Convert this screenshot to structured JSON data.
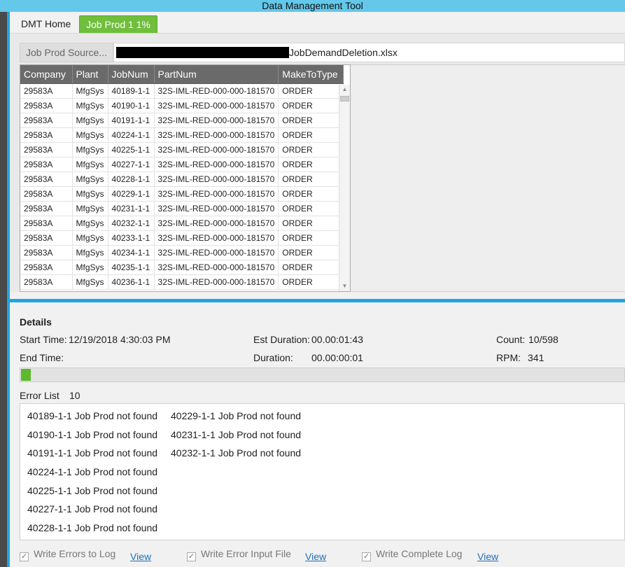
{
  "window": {
    "title": "Data Management Tool"
  },
  "tabs": [
    {
      "label": "DMT Home",
      "active": false
    },
    {
      "label": "Job Prod 1 1%",
      "active": true
    }
  ],
  "colors": {
    "accent_blue": "#1ea6e0",
    "tab_green": "#6fbe3c",
    "progress_green": "#5cba2c",
    "title_bar": "#63c8ea"
  },
  "source": {
    "button_label": "Job Prod Source...",
    "file_suffix": "JobDemandDeletion.xlsx"
  },
  "grid": {
    "columns": [
      "Company",
      "Plant",
      "JobNum",
      "PartNum",
      "MakeToType"
    ],
    "rows": [
      [
        "29583A",
        "MfgSys",
        "40189-1-1",
        "32S-IML-RED-000-000-181570",
        "ORDER"
      ],
      [
        "29583A",
        "MfgSys",
        "40190-1-1",
        "32S-IML-RED-000-000-181570",
        "ORDER"
      ],
      [
        "29583A",
        "MfgSys",
        "40191-1-1",
        "32S-IML-RED-000-000-181570",
        "ORDER"
      ],
      [
        "29583A",
        "MfgSys",
        "40224-1-1",
        "32S-IML-RED-000-000-181570",
        "ORDER"
      ],
      [
        "29583A",
        "MfgSys",
        "40225-1-1",
        "32S-IML-RED-000-000-181570",
        "ORDER"
      ],
      [
        "29583A",
        "MfgSys",
        "40227-1-1",
        "32S-IML-RED-000-000-181570",
        "ORDER"
      ],
      [
        "29583A",
        "MfgSys",
        "40228-1-1",
        "32S-IML-RED-000-000-181570",
        "ORDER"
      ],
      [
        "29583A",
        "MfgSys",
        "40229-1-1",
        "32S-IML-RED-000-000-181570",
        "ORDER"
      ],
      [
        "29583A",
        "MfgSys",
        "40231-1-1",
        "32S-IML-RED-000-000-181570",
        "ORDER"
      ],
      [
        "29583A",
        "MfgSys",
        "40232-1-1",
        "32S-IML-RED-000-000-181570",
        "ORDER"
      ],
      [
        "29583A",
        "MfgSys",
        "40233-1-1",
        "32S-IML-RED-000-000-181570",
        "ORDER"
      ],
      [
        "29583A",
        "MfgSys",
        "40234-1-1",
        "32S-IML-RED-000-000-181570",
        "ORDER"
      ],
      [
        "29583A",
        "MfgSys",
        "40235-1-1",
        "32S-IML-RED-000-000-181570",
        "ORDER"
      ],
      [
        "29583A",
        "MfgSys",
        "40236-1-1",
        "32S-IML-RED-000-000-181570",
        "ORDER"
      ]
    ]
  },
  "details": {
    "heading": "Details",
    "start_time_label": "Start Time:",
    "start_time_value": "12/19/2018 4:30:03 PM",
    "end_time_label": "End Time:",
    "end_time_value": "",
    "est_duration_label": "Est Duration:",
    "est_duration_value": "00.00:01:43",
    "duration_label": "Duration:",
    "duration_value": "00.00:00:01",
    "count_label": "Count:",
    "count_value": "10/598",
    "rpm_label": "RPM:",
    "rpm_value": "341",
    "progress_fraction": 0.0167
  },
  "errors": {
    "label": "Error List",
    "count": "10",
    "column1": [
      "40189-1-1  Job Prod not found",
      "40190-1-1  Job Prod not found",
      "40191-1-1  Job Prod not found",
      "40224-1-1  Job Prod not found",
      "40225-1-1  Job Prod not found",
      "40227-1-1  Job Prod not found",
      "40228-1-1  Job Prod not found"
    ],
    "column2": [
      "40229-1-1  Job Prod not found",
      "40231-1-1  Job Prod not found",
      "40232-1-1  Job Prod not found"
    ]
  },
  "options": {
    "write_errors_label": "Write Errors to Log",
    "write_error_input_label": "Write Error Input File",
    "write_complete_label": "Write Complete Log",
    "view_label": "View",
    "checked_mark": "✓"
  },
  "icons": {
    "scroll_up": "▲",
    "scroll_down": "▼"
  }
}
